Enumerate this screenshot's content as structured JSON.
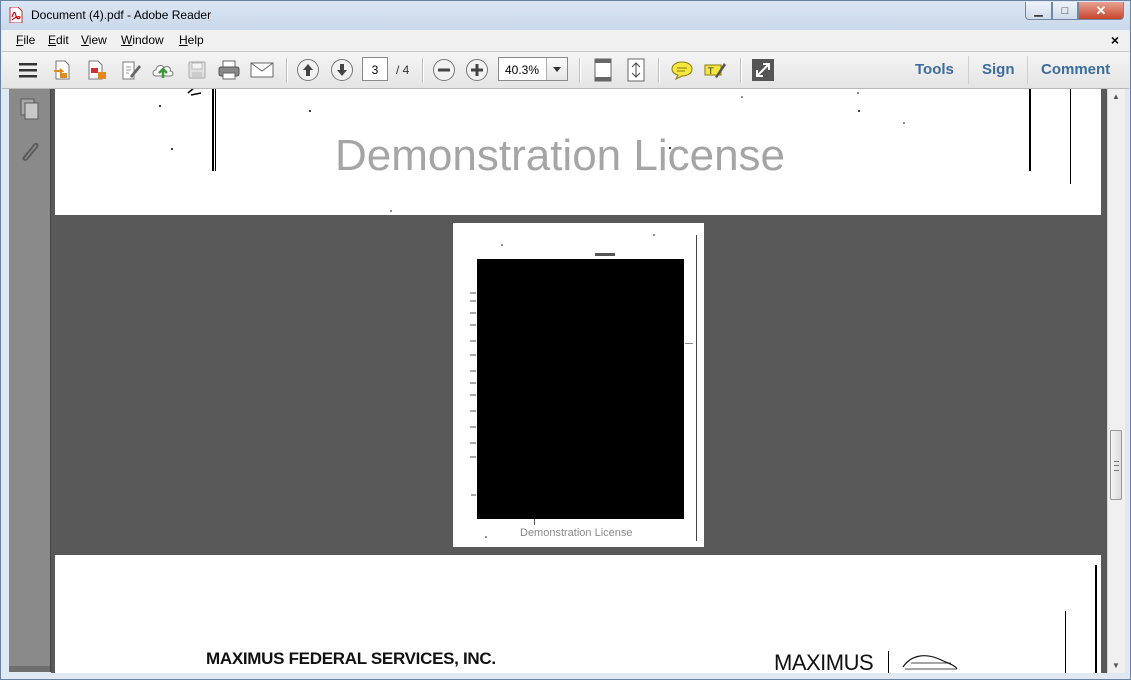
{
  "window": {
    "title": "Document (4).pdf - Adobe Reader",
    "minimize_glyph": "▁",
    "maximize_glyph": "□",
    "close_glyph": "✕"
  },
  "menu": {
    "items": [
      {
        "label": "File",
        "accel": "F",
        "rest": "ile"
      },
      {
        "label": "Edit",
        "accel": "E",
        "rest": "dit"
      },
      {
        "label": "View",
        "accel": "V",
        "rest": "iew"
      },
      {
        "label": "Window",
        "accel": "W",
        "rest": "indow"
      },
      {
        "label": "Help",
        "accel": "H",
        "rest": "elp"
      }
    ],
    "close_glyph": "×"
  },
  "toolbar": {
    "icons": [
      "hamburger-menu-icon",
      "create-pdf-icon",
      "export-pdf-icon",
      "edit-pdf-icon",
      "upload-cloud-icon",
      "save-icon",
      "print-icon",
      "email-icon",
      "previous-page-icon",
      "next-page-icon",
      "zoom-out-icon",
      "zoom-in-icon",
      "fit-page-icon",
      "fit-width-icon",
      "comment-icon",
      "highlight-icon",
      "full-screen-icon"
    ],
    "current_page": "3",
    "total_pages": "/ 4",
    "zoom": "40.3%"
  },
  "panels": {
    "tools": "Tools",
    "sign": "Sign",
    "comment": "Comment"
  },
  "document": {
    "watermark_large": "Demonstration License",
    "watermark_small": "Demonstration License",
    "company_name": "MAXIMUS FEDERAL SERVICES, INC.",
    "brand_name": "MAXIMUS"
  },
  "colors": {
    "panel_link": "#3d6c9e",
    "doc_background": "#595959",
    "watermark": "#a5a5a5"
  }
}
